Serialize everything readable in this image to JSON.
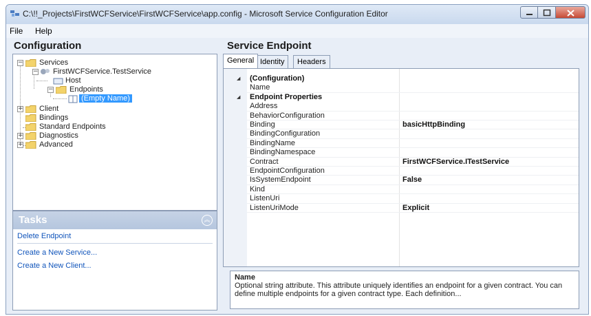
{
  "window": {
    "title": "C:\\!!_Projects\\FirstWCFService\\FirstWCFService\\app.config - Microsoft Service Configuration Editor"
  },
  "menu": [
    "File",
    "Help"
  ],
  "left_panel": {
    "header": "Configuration",
    "tree": {
      "services": "Services",
      "service": "FirstWCFService.TestService",
      "host": "Host",
      "endpoints": "Endpoints",
      "empty_name": "(Empty Name)",
      "client": "Client",
      "bindings": "Bindings",
      "standard_endpoints": "Standard Endpoints",
      "diagnostics": "Diagnostics",
      "advanced": "Advanced"
    }
  },
  "tasks": {
    "title": "Tasks",
    "items": [
      "Delete Endpoint",
      "Create a New Service...",
      "Create a New Client..."
    ]
  },
  "right_panel": {
    "header": "Service Endpoint",
    "tabs": [
      "General",
      "Identity",
      "Headers"
    ],
    "active_tab": "General",
    "grid": {
      "categories": {
        "configuration": "(Configuration)",
        "endpoint_properties": "Endpoint Properties"
      },
      "properties": [
        {
          "name": "Name",
          "value": ""
        },
        {
          "name": "Address",
          "value": ""
        },
        {
          "name": "BehaviorConfiguration",
          "value": ""
        },
        {
          "name": "Binding",
          "value": "basicHttpBinding"
        },
        {
          "name": "BindingConfiguration",
          "value": ""
        },
        {
          "name": "BindingName",
          "value": ""
        },
        {
          "name": "BindingNamespace",
          "value": ""
        },
        {
          "name": "Contract",
          "value": "FirstWCFService.ITestService"
        },
        {
          "name": "EndpointConfiguration",
          "value": ""
        },
        {
          "name": "IsSystemEndpoint",
          "value": "False"
        },
        {
          "name": "Kind",
          "value": ""
        },
        {
          "name": "ListenUri",
          "value": ""
        },
        {
          "name": "ListenUriMode",
          "value": "Explicit"
        }
      ]
    },
    "description": {
      "title": "Name",
      "text": "Optional string attribute. This attribute uniquely identifies an endpoint for a given contract. You can define multiple endpoints for a given contract type. Each definition..."
    }
  },
  "colors": {
    "selection": "#3399ff",
    "link": "#1155bb",
    "tasks_header": "#b5c6de"
  },
  "icons": {
    "collapse": "minus-icon",
    "expand": "plus-icon",
    "category_collapse": "triangle-down-icon"
  }
}
